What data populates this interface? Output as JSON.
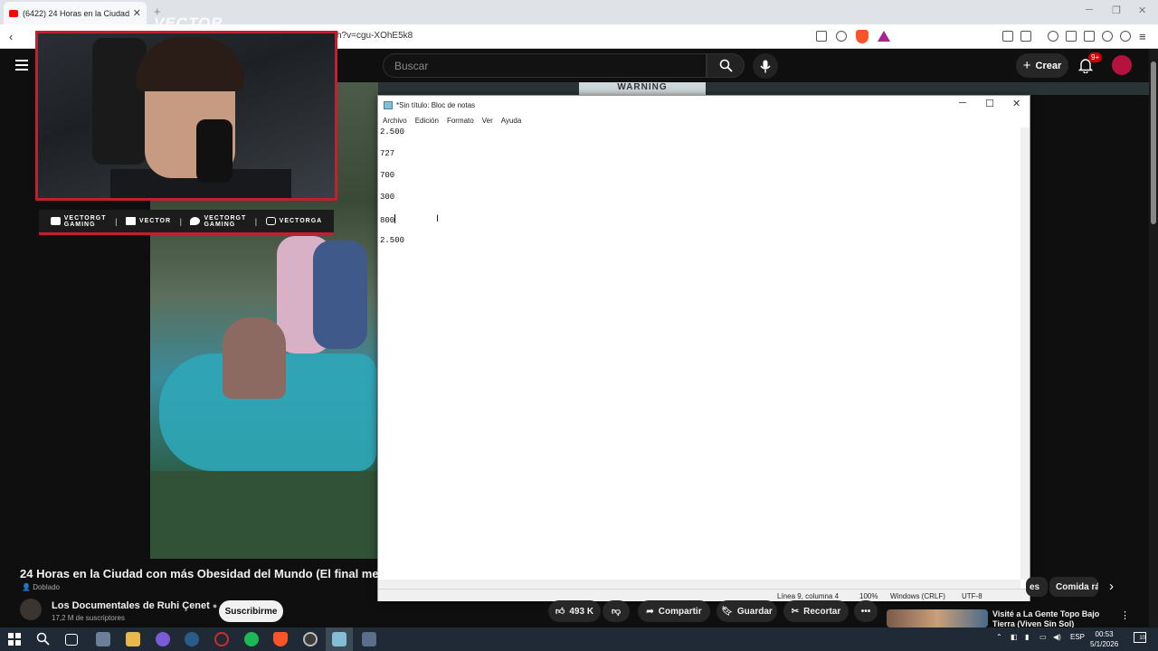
{
  "browser": {
    "tab_title": "(6422) 24 Horas en la Ciudad con",
    "url": "h?v=cgu-XOhE5k8"
  },
  "youtube": {
    "search_placeholder": "Buscar",
    "create_label": "Crear",
    "notifications_badge": "9+",
    "video_title": "24 Horas en la Ciudad con más Obesidad del Mundo (El final me im",
    "dubbed_label": "Doblado",
    "channel_name": "Los Documentales de Ruhi Çenet",
    "channel_subs": "17,2 M de suscriptores",
    "subscribe_label": "Suscribirme",
    "likes": "493 K",
    "share_label": "Compartir",
    "save_label": "Guardar",
    "clip_label": "Recortar",
    "chips": [
      "es",
      "Comida rá"
    ],
    "rec_title": "Visité a La Gente Topo Bajo Tierra (Viven Sin Sol)",
    "sign_text": "WARNING"
  },
  "overlay": {
    "logo_text": "VECTOR",
    "socials": [
      {
        "line1": "VECTORGT",
        "line2": "GAMING"
      },
      {
        "line1": "VECTOR",
        "line2": ""
      },
      {
        "line1": "VECTORGT",
        "line2": "GAMING"
      },
      {
        "line1": "VECTORGA",
        "line2": ""
      }
    ]
  },
  "notepad": {
    "title": "*Sin título: Bloc de notas",
    "menu": [
      "Archivo",
      "Edición",
      "Formato",
      "Ver",
      "Ayuda"
    ],
    "lines": [
      "2.500",
      "727",
      "700",
      "300",
      "800",
      "2.500"
    ],
    "status": {
      "position": "Línea 9, columna 4",
      "zoom": "100%",
      "line_ending": "Windows (CRLF)",
      "encoding": "UTF-8"
    }
  },
  "taskbar": {
    "language": "ESP",
    "time": "00:53",
    "date": "5/1/2026",
    "notification_count": "10"
  },
  "colors": {
    "youtube_bg": "#0f0f0f",
    "overlay_red": "#c3202f",
    "taskbar": "#1f2a36"
  }
}
